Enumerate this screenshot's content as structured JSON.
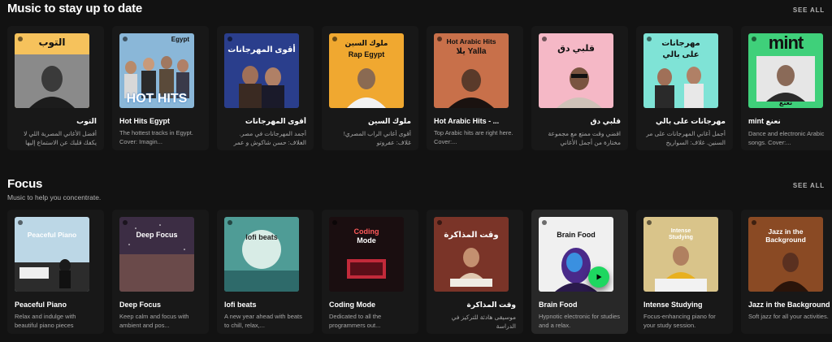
{
  "sections": [
    {
      "title": "Music to stay up to date",
      "see_all": "SEE ALL",
      "cards": [
        {
          "cover_text": "التوب",
          "title": "التوب",
          "desc": "أفضل الأغاني المصرية اللي لا يكفك قلبك عن الاستماع إليها",
          "desc_dir": "rtl"
        },
        {
          "cover_text": "HOT HITS",
          "cover_tag": "Egypt",
          "title": "Hot Hits Egypt",
          "desc": "The hottest tracks in Egypt. Cover: Imagin...",
          "desc_dir": "ltr"
        },
        {
          "cover_text": "أقوى المهرجانات",
          "title": "أقوى المهرجانات",
          "desc": "أجمد المهرجانات في مصر. الغلاف: حسن شاكوش و عمر",
          "desc_dir": "rtl"
        },
        {
          "cover_text": "ملوك السين",
          "cover_sub": "Rap Egypt",
          "title": "ملوك السين",
          "desc": "أقوى أغاني الراب المصري! غلاف: عفروتو",
          "desc_dir": "rtl"
        },
        {
          "cover_text": "Hot Arabic Hits",
          "cover_sub": "يلا Yalla",
          "title": "Hot Arabic Hits - ...",
          "desc": "Top Arabic hits are right here. Cover:...",
          "desc_dir": "ltr"
        },
        {
          "cover_text": "قلبي دق",
          "title": "قلبي دق",
          "desc": "اقضي وقت ممتع مع مجموعة مختارة من أجمل الأغاني",
          "desc_dir": "rtl"
        },
        {
          "cover_text": "مهرجانات",
          "cover_sub": "على بالي",
          "title": "مهرجانات على بالي",
          "desc": "أجمل أغاني المهرجانات على مر السنين. غلاف: السواريخ",
          "desc_dir": "rtl"
        },
        {
          "cover_text": "mint",
          "cover_sub": "نعنع",
          "title": "mint نعنع",
          "desc": "Dance and electronic Arabic songs. Cover:...",
          "desc_dir": "ltr"
        }
      ]
    },
    {
      "title": "Focus",
      "subtitle": "Music to help you concentrate.",
      "see_all": "SEE ALL",
      "cards": [
        {
          "cover_text": "Peaceful Piano",
          "title": "Peaceful Piano",
          "desc": "Relax and indulge with beautiful piano pieces",
          "desc_dir": "ltr"
        },
        {
          "cover_text": "Deep Focus",
          "title": "Deep Focus",
          "desc": "Keep calm and focus with ambient and pos...",
          "desc_dir": "ltr"
        },
        {
          "cover_text": "lofi beats",
          "title": "lofi beats",
          "desc": "A new year ahead with beats to chill, relax,...",
          "desc_dir": "ltr"
        },
        {
          "cover_text": "Coding",
          "cover_sub": "Mode",
          "title": "Coding Mode",
          "desc": "Dedicated to all the programmers out...",
          "desc_dir": "ltr"
        },
        {
          "cover_text": "وقت المذاكرة",
          "title": "وقت المذاكرة",
          "desc": "موسيقى هادئة للتركيز في الدراسة",
          "desc_dir": "rtl"
        },
        {
          "cover_text": "Brain Food",
          "title": "Brain Food",
          "desc": "Hypnotic electronic for studies and a relax.",
          "desc_dir": "ltr"
        },
        {
          "cover_text": "Intense",
          "cover_sub": "Studying",
          "title": "Intense Studying",
          "desc": "Focus-enhancing piano for your study session.",
          "desc_dir": "ltr"
        },
        {
          "cover_text": "Jazz in the",
          "cover_sub": "Background",
          "title": "Jazz in the Background",
          "desc": "Soft jazz for all your activities.",
          "desc_dir": "ltr"
        }
      ]
    }
  ],
  "colors": {
    "background": "#121212",
    "card": "#181818",
    "card_hover": "#282828",
    "play": "#1ed760",
    "subtext": "#a7a7a7"
  }
}
